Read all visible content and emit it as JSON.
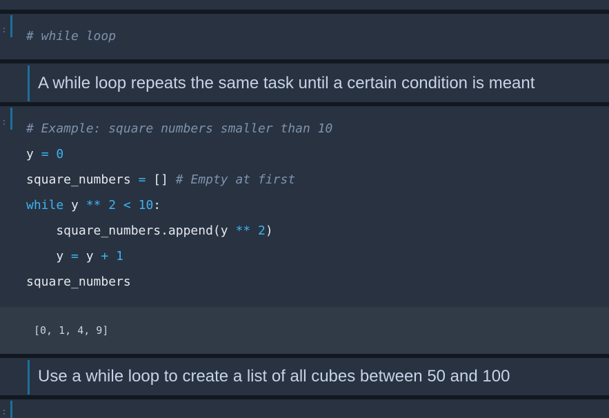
{
  "cells": {
    "c1": {
      "prompt": ":",
      "comment": "# while loop"
    },
    "md1": {
      "text": "A while loop repeats the same task until a certain condition is meant"
    },
    "c2": {
      "prompt": ":",
      "line1": "# Example: square numbers smaller than 10",
      "line2": {
        "a": "y ",
        "b": "=",
        "c": " ",
        "d": "0"
      },
      "line3": {
        "a": "square_numbers ",
        "b": "=",
        "c": " [] ",
        "d": "# Empty at first"
      },
      "line4": {
        "a": "while",
        "b": " y ",
        "c": "**",
        "d": " ",
        "e": "2",
        "f": " ",
        "g": "<",
        "h": " ",
        "i": "10",
        "j": ":"
      },
      "line5": {
        "a": "    square_numbers.append(y ",
        "b": "**",
        "c": " ",
        "d": "2",
        "e": ")"
      },
      "line6": {
        "a": "    y ",
        "b": "=",
        "c": " y ",
        "d": "+",
        "e": " ",
        "f": "1"
      },
      "line7": "square_numbers"
    },
    "out2": {
      "text": "[0, 1, 4, 9]"
    },
    "md2": {
      "text": "Use a while loop to create a list of all cubes between 50 and 100"
    },
    "c3": {
      "prompt": ":"
    }
  },
  "colors": {
    "background": "#1b222b",
    "cell": "#283241",
    "output": "#313a47",
    "accent": "#1f6f9a",
    "keyword": "#3fb3ef",
    "comment": "#7f93ad",
    "text": "#e6e9ef",
    "markdown_text": "#c7d3e6"
  }
}
